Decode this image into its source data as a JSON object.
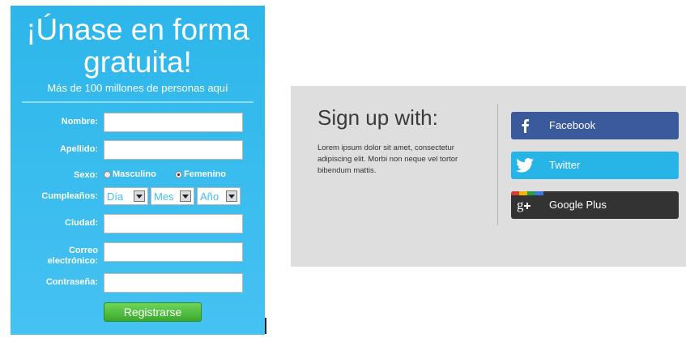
{
  "signup_form": {
    "title_line1": "¡Únase en forma",
    "title_line2": "gratuita!",
    "subtitle": "Más de 100 millones de personas aquí",
    "labels": {
      "first_name": "Nombre:",
      "last_name": "Apellido:",
      "sex": "Sexo:",
      "birthday": "Cumpleaños:",
      "city": "Ciudad:",
      "email_line1": "Correo",
      "email_line2": "electrónico:",
      "password": "Contraseña:"
    },
    "sex_options": [
      "Masculino",
      "Femenino"
    ],
    "sex_selected": "Femenino",
    "birthday_selects": {
      "day": "Día",
      "month": "Mes",
      "year": "Año"
    },
    "submit_label": "Registrarse"
  },
  "social_signup": {
    "title": "Sign up with:",
    "description": "Lorem ipsum dolor sit amet, consectetur adipiscing elit. Morbi non neque vel tortor bibendum mattis.",
    "buttons": [
      {
        "label": "Facebook",
        "icon": "facebook-icon",
        "color": "#3b5a9b"
      },
      {
        "label": "Twitter",
        "icon": "twitter-bird-icon",
        "color": "#27b5e8"
      },
      {
        "label": "Google Plus",
        "icon": "google-plus-icon",
        "color": "#333333"
      }
    ],
    "google_stripe_colors": [
      "#d53d2d",
      "#f4b400",
      "#2a9b4b",
      "#3b78e7"
    ]
  }
}
